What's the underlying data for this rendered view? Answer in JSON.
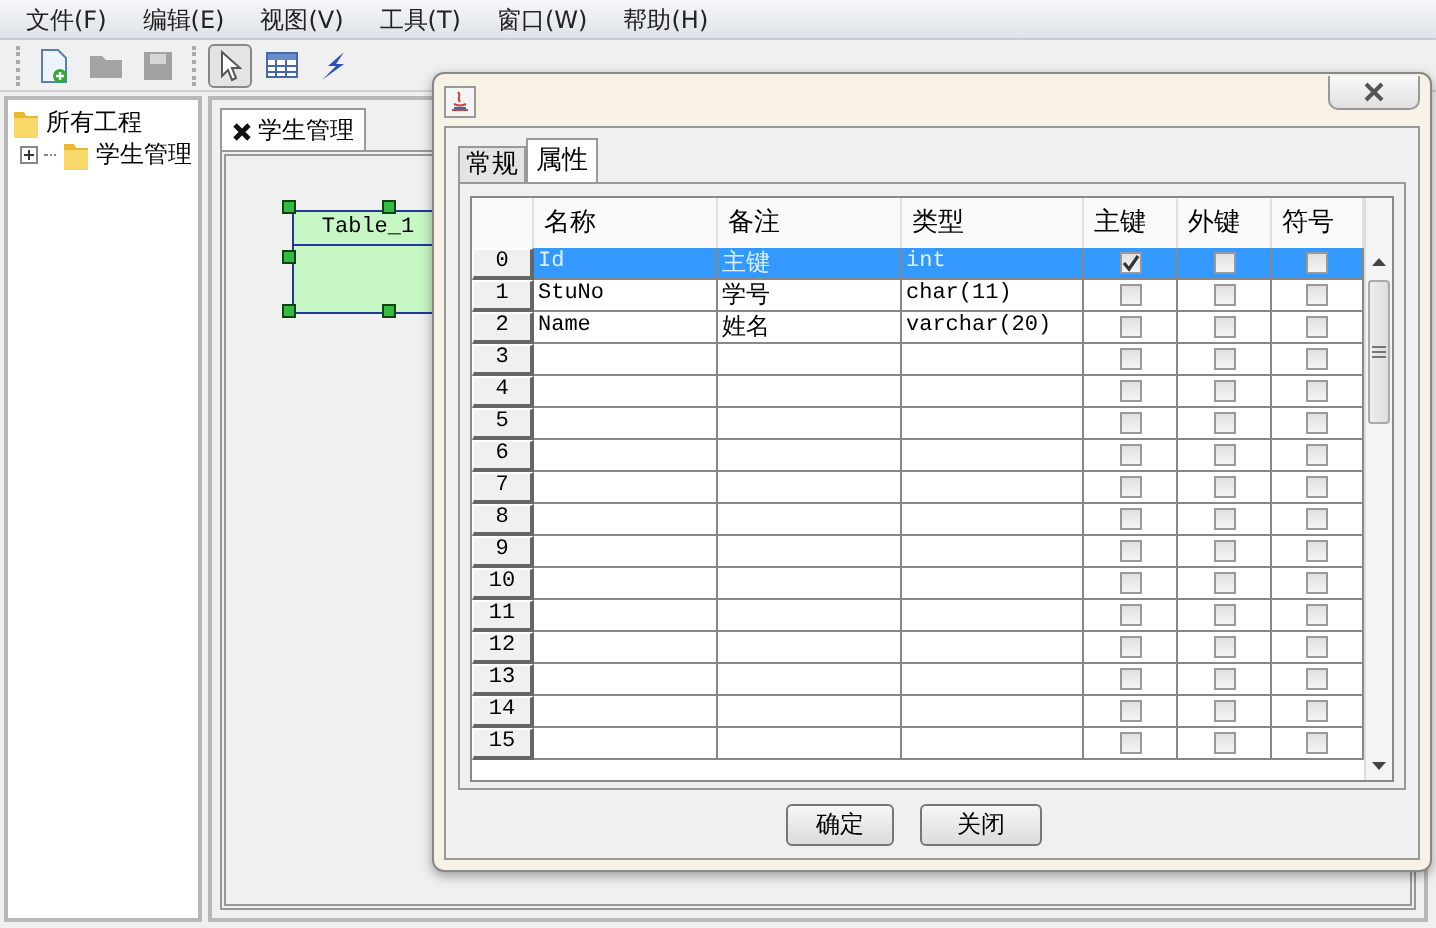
{
  "menu": [
    "文件(F)",
    "编辑(E)",
    "视图(V)",
    "工具(T)",
    "窗口(W)",
    "帮助(H)"
  ],
  "toolbar": [
    {
      "kind": "new",
      "disabled": false,
      "selected": false
    },
    {
      "kind": "open",
      "disabled": true,
      "selected": false
    },
    {
      "kind": "save",
      "disabled": true,
      "selected": false
    },
    {
      "kind": "pointer",
      "disabled": false,
      "selected": true
    },
    {
      "kind": "table",
      "disabled": false,
      "selected": false
    },
    {
      "kind": "relation",
      "disabled": false,
      "selected": false
    }
  ],
  "tree": {
    "label": "所有工程",
    "children": [
      {
        "label": "学生管理",
        "expanded": false
      }
    ]
  },
  "editor_tabs": [
    {
      "label": "学生管理",
      "selected": true
    }
  ],
  "diagram": {
    "entities": [
      {
        "name": "Table_1",
        "selected": true
      }
    ]
  },
  "dialog": {
    "tabs": [
      {
        "label": "常规",
        "selected": false
      },
      {
        "label": "属性",
        "selected": true
      }
    ],
    "table": {
      "columns": [
        "名称",
        "备注",
        "类型",
        "主键",
        "外键",
        "符号"
      ],
      "rows": [
        {
          "index": "0",
          "name": "Id",
          "note": "主键",
          "type": "int",
          "primary_key": true,
          "foreign_key": false,
          "sign": false,
          "selected": true
        },
        {
          "index": "1",
          "name": "StuNo",
          "note": "学号",
          "type": "char(11)",
          "primary_key": false,
          "foreign_key": false,
          "sign": false,
          "selected": false
        },
        {
          "index": "2",
          "name": "Name",
          "note": "姓名",
          "type": "varchar(20)",
          "primary_key": false,
          "foreign_key": false,
          "sign": false,
          "selected": false
        },
        {
          "index": "3",
          "primary_key": false,
          "foreign_key": false,
          "sign": false,
          "selected": false
        },
        {
          "index": "4",
          "primary_key": false,
          "foreign_key": false,
          "sign": false,
          "selected": false
        },
        {
          "index": "5",
          "primary_key": false,
          "foreign_key": false,
          "sign": false,
          "selected": false
        },
        {
          "index": "6",
          "primary_key": false,
          "foreign_key": false,
          "sign": false,
          "selected": false
        },
        {
          "index": "7",
          "primary_key": false,
          "foreign_key": false,
          "sign": false,
          "selected": false
        },
        {
          "index": "8",
          "primary_key": false,
          "foreign_key": false,
          "sign": false,
          "selected": false
        },
        {
          "index": "9",
          "primary_key": false,
          "foreign_key": false,
          "sign": false,
          "selected": false
        },
        {
          "index": "10",
          "primary_key": false,
          "foreign_key": false,
          "sign": false,
          "selected": false
        },
        {
          "index": "11",
          "primary_key": false,
          "foreign_key": false,
          "sign": false,
          "selected": false
        },
        {
          "index": "12",
          "primary_key": false,
          "foreign_key": false,
          "sign": false,
          "selected": false
        },
        {
          "index": "13",
          "primary_key": false,
          "foreign_key": false,
          "sign": false,
          "selected": false
        },
        {
          "index": "14",
          "primary_key": false,
          "foreign_key": false,
          "sign": false,
          "selected": false
        },
        {
          "index": "15",
          "primary_key": false,
          "foreign_key": false,
          "sign": false,
          "selected": false
        }
      ]
    },
    "buttons": [
      "确定",
      "关闭"
    ]
  }
}
